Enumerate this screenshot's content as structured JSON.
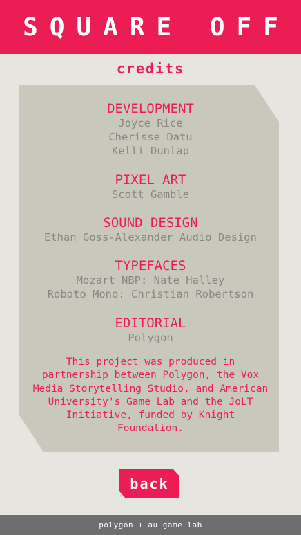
{
  "header": {
    "title": "SQUARE OFF"
  },
  "subtitle": "credits",
  "credits": {
    "development": {
      "heading": "DEVELOPMENT",
      "names": [
        "Joyce Rice",
        "Cherisse Datu",
        "Kelli Dunlap"
      ]
    },
    "pixel_art": {
      "heading": "PIXEL ART",
      "names": [
        "Scott Gamble"
      ]
    },
    "sound_design": {
      "heading": "SOUND DESIGN",
      "names": [
        "Ethan Goss-Alexander Audio Design"
      ]
    },
    "typefaces": {
      "heading": "TYPEFACES",
      "names": [
        "Mozart NBP: Nate Halley",
        "Roboto Mono: Christian Robertson"
      ]
    },
    "editorial": {
      "heading": "EDITORIAL",
      "names": [
        "Polygon"
      ]
    }
  },
  "blurb": "This project was produced in partnership between Polygon, the Vox Media Storytelling Studio, and American University's Game Lab and the JoLT Initiative, funded by Knight Foundation.",
  "back_button": {
    "label": "back"
  },
  "footer": {
    "label": "polygon + au game lab"
  },
  "colors": {
    "accent": "#ec1c54",
    "background": "#e6e5e0",
    "panel": "#c9c8bd",
    "name_text": "#878781",
    "footer": "#6e6e6e"
  }
}
